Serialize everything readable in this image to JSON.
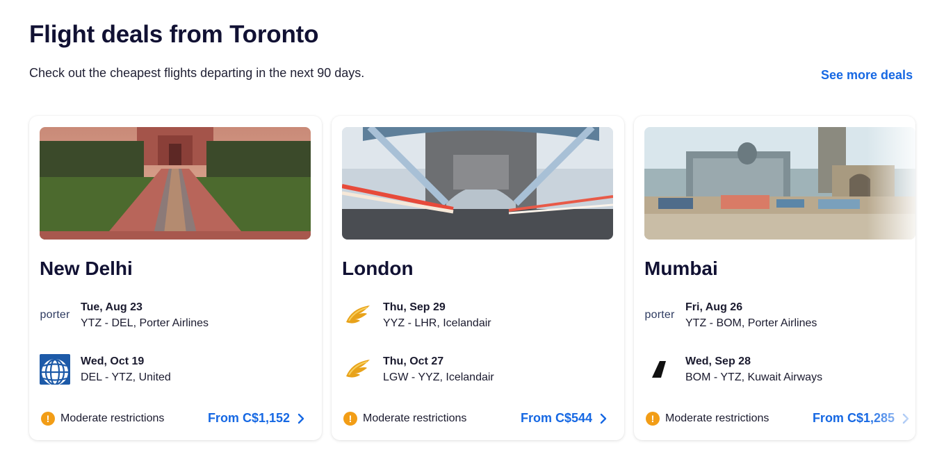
{
  "header": {
    "title": "Flight deals from Toronto",
    "subtitle": "Check out the cheapest flights departing in the next 90 days.",
    "see_more": "See more deals"
  },
  "colors": {
    "accent": "#1668e3",
    "warning": "#f29d16",
    "text": "#111133"
  },
  "cards": [
    {
      "city": "New Delhi",
      "flights": [
        {
          "airline_logo": "porter-logo",
          "logo_text": "porter",
          "date": "Tue, Aug 23",
          "route": "YTZ - DEL, Porter Airlines"
        },
        {
          "airline_logo": "united-globe-logo",
          "date": "Wed, Oct 19",
          "route": "DEL - YTZ, United"
        }
      ],
      "restrictions": "Moderate restrictions",
      "price": "From C$1,152"
    },
    {
      "city": "London",
      "flights": [
        {
          "airline_logo": "icelandair-wing-logo",
          "date": "Thu, Sep 29",
          "route": "YYZ - LHR, Icelandair"
        },
        {
          "airline_logo": "icelandair-wing-logo",
          "date": "Thu, Oct 27",
          "route": "LGW - YYZ, Icelandair"
        }
      ],
      "restrictions": "Moderate restrictions",
      "price": "From C$544"
    },
    {
      "city": "Mumbai",
      "flights": [
        {
          "airline_logo": "porter-logo",
          "logo_text": "porter",
          "date": "Fri, Aug 26",
          "route": "YTZ - BOM, Porter Airlines"
        },
        {
          "airline_logo": "kuwait-airways-tail-logo",
          "date": "Wed, Sep 28",
          "route": "BOM - YTZ, Kuwait Airways"
        }
      ],
      "restrictions": "Moderate restrictions",
      "price": "From C$1,285"
    }
  ]
}
